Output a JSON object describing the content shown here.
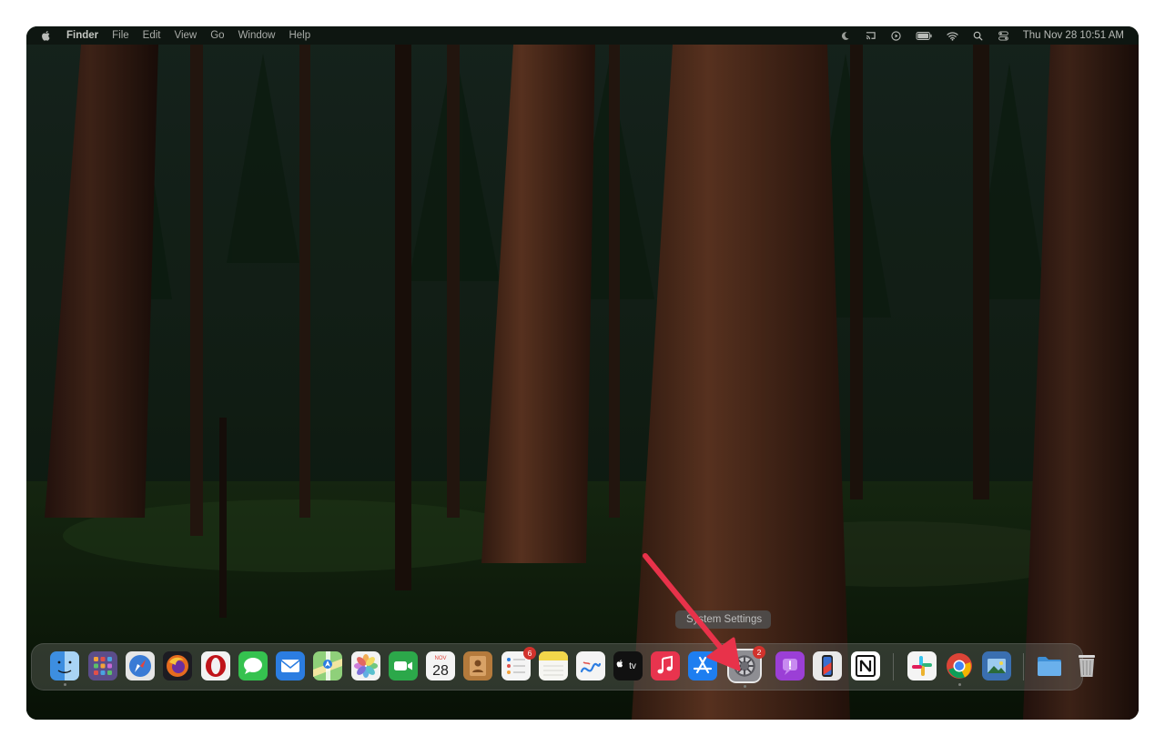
{
  "menubar": {
    "app_name": "Finder",
    "menus": [
      "File",
      "Edit",
      "View",
      "Go",
      "Window",
      "Help"
    ],
    "status_icons": [
      "moon-icon",
      "cast-icon",
      "play-icon",
      "battery-icon",
      "wifi-icon",
      "search-icon",
      "control-center-icon"
    ],
    "datetime": "Thu Nov 28  10:51 AM"
  },
  "dock": {
    "apps": [
      {
        "icon": "finder-icon",
        "color": "#2a6fb8",
        "running": true
      },
      {
        "icon": "launchpad-icon",
        "color": "#6a4b9a"
      },
      {
        "icon": "safari-icon",
        "color": "#3a7bd5"
      },
      {
        "icon": "firefox-icon",
        "color": "#c8541f"
      },
      {
        "icon": "opera-icon",
        "color": "#c0141a"
      },
      {
        "icon": "messages-icon",
        "color": "#2fb84a"
      },
      {
        "icon": "mail-icon",
        "color": "#2b7de1"
      },
      {
        "icon": "maps-icon",
        "color": "#5cae5a"
      },
      {
        "icon": "photos-icon",
        "color": "#e0a030"
      },
      {
        "icon": "facetime-icon",
        "color": "#2ca84a"
      },
      {
        "icon": "calendar-icon",
        "color": "#f2f2f2",
        "month": "NOV",
        "day": "28"
      },
      {
        "icon": "contacts-icon",
        "color": "#b47a3c"
      },
      {
        "icon": "reminders-icon",
        "color": "#f2f2f2",
        "badge": "6"
      },
      {
        "icon": "notes-icon",
        "color": "#f2d74a"
      },
      {
        "icon": "freeform-icon",
        "color": "#f2f2f2"
      },
      {
        "icon": "apple-tv-icon",
        "color": "#111111",
        "label": "tv"
      },
      {
        "icon": "music-icon",
        "color": "#e8344e"
      },
      {
        "icon": "app-store-icon",
        "color": "#1e7ef0"
      },
      {
        "icon": "system-settings-icon",
        "color": "#8e8e93",
        "badge": "2",
        "running": true,
        "highlighted": true
      },
      {
        "icon": "podcasts-icon",
        "color": "#9b3fd6"
      },
      {
        "icon": "iphone-mirroring-icon",
        "color": "#e9e9e9"
      },
      {
        "icon": "notion-icon",
        "color": "#ffffff"
      },
      {
        "icon": "slack-icon",
        "color": "#ffffff"
      },
      {
        "icon": "chrome-icon",
        "color": "#ffffff",
        "running": true
      },
      {
        "icon": "preview-icon",
        "color": "#3a6fb0"
      }
    ],
    "trailing": [
      {
        "icon": "downloads-folder-icon",
        "color": "#3e8fd6"
      },
      {
        "icon": "trash-icon",
        "color": "#cfcfcf"
      }
    ]
  },
  "tooltip": {
    "text": "System Settings"
  },
  "colors": {
    "arrow": "#e8324a",
    "badge": "#d2322c"
  }
}
